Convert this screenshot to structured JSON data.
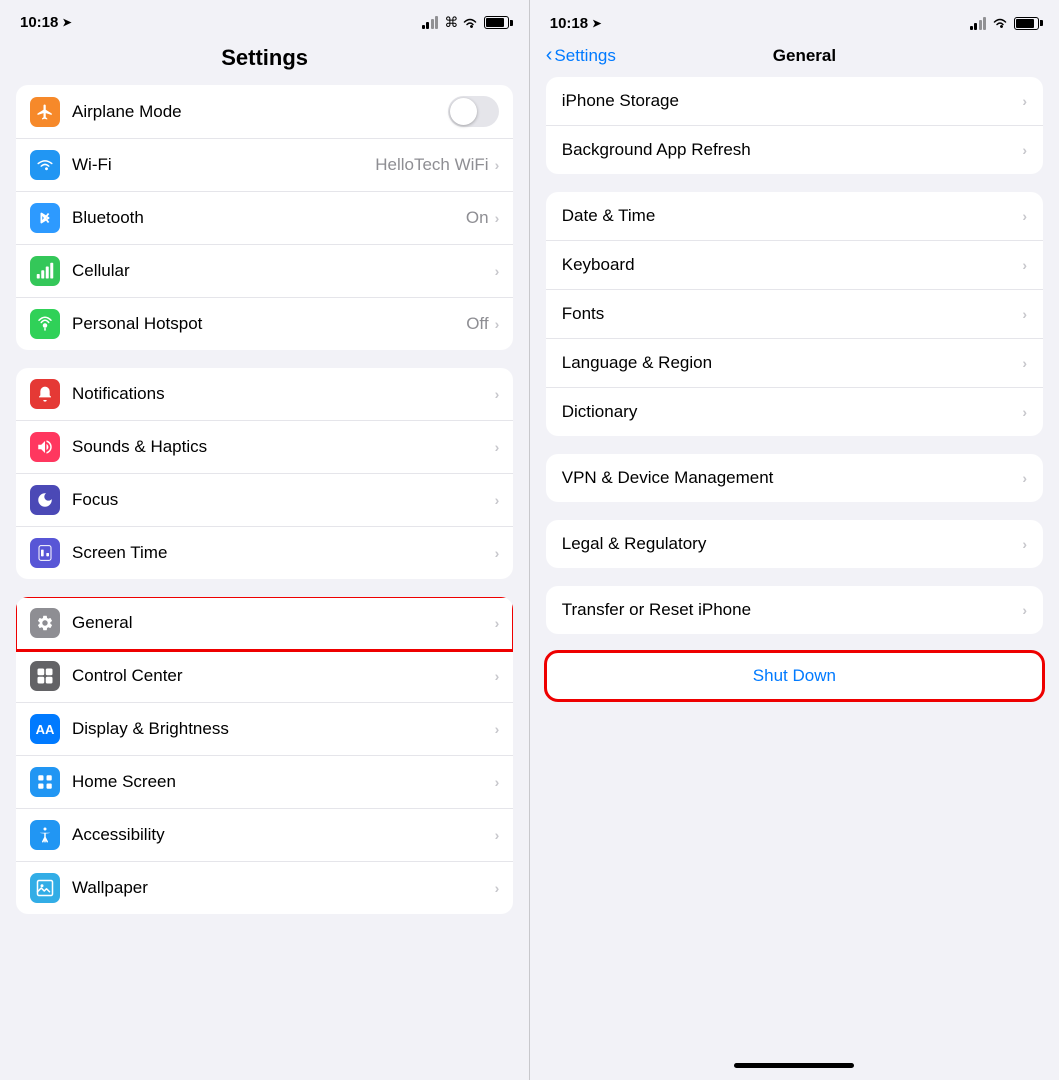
{
  "left": {
    "status": {
      "time": "10:18",
      "arrow": "➤"
    },
    "title": "Settings",
    "groups": [
      {
        "id": "connectivity",
        "rows": [
          {
            "id": "airplane",
            "icon": "✈",
            "iconClass": "icon-orange",
            "label": "Airplane Mode",
            "value": "",
            "type": "toggle",
            "toggleOn": false
          },
          {
            "id": "wifi",
            "icon": "wifi",
            "iconClass": "icon-blue",
            "label": "Wi-Fi",
            "value": "HelloTech WiFi",
            "type": "chevron"
          },
          {
            "id": "bluetooth",
            "icon": "bluetooth",
            "iconClass": "icon-blue-mid",
            "label": "Bluetooth",
            "value": "On",
            "type": "chevron"
          },
          {
            "id": "cellular",
            "icon": "cellular",
            "iconClass": "icon-green",
            "label": "Cellular",
            "value": "",
            "type": "chevron"
          },
          {
            "id": "hotspot",
            "icon": "hotspot",
            "iconClass": "icon-green-mid",
            "label": "Personal Hotspot",
            "value": "Off",
            "type": "chevron"
          }
        ]
      },
      {
        "id": "system1",
        "rows": [
          {
            "id": "notifications",
            "icon": "notif",
            "iconClass": "icon-red",
            "label": "Notifications",
            "value": "",
            "type": "chevron"
          },
          {
            "id": "sounds",
            "icon": "sounds",
            "iconClass": "icon-pink",
            "label": "Sounds & Haptics",
            "value": "",
            "type": "chevron"
          },
          {
            "id": "focus",
            "icon": "focus",
            "iconClass": "icon-indigo",
            "label": "Focus",
            "value": "",
            "type": "chevron"
          },
          {
            "id": "screentime",
            "icon": "screentime",
            "iconClass": "icon-purple",
            "label": "Screen Time",
            "value": "",
            "type": "chevron"
          }
        ]
      },
      {
        "id": "system2",
        "rows": [
          {
            "id": "general",
            "icon": "gear",
            "iconClass": "icon-gray",
            "label": "General",
            "value": "",
            "type": "chevron",
            "highlighted": true
          },
          {
            "id": "controlcenter",
            "icon": "cc",
            "iconClass": "icon-gray-dark",
            "label": "Control Center",
            "value": "",
            "type": "chevron"
          },
          {
            "id": "display",
            "icon": "AA",
            "iconClass": "icon-blue-bright",
            "label": "Display & Brightness",
            "value": "",
            "type": "chevron"
          },
          {
            "id": "homescreen",
            "icon": "home",
            "iconClass": "icon-blue",
            "label": "Home Screen",
            "value": "",
            "type": "chevron"
          },
          {
            "id": "accessibility",
            "icon": "access",
            "iconClass": "icon-blue",
            "label": "Accessibility",
            "value": "",
            "type": "chevron"
          },
          {
            "id": "wallpaper",
            "icon": "wp",
            "iconClass": "icon-teal",
            "label": "Wallpaper",
            "value": "",
            "type": "chevron"
          }
        ]
      }
    ]
  },
  "right": {
    "status": {
      "time": "10:18",
      "arrow": "➤"
    },
    "nav": {
      "backLabel": "Settings",
      "title": "General"
    },
    "groups": [
      {
        "id": "storage",
        "rows": [
          {
            "id": "iphone-storage",
            "label": "iPhone Storage",
            "type": "chevron"
          },
          {
            "id": "bg-refresh",
            "label": "Background App Refresh",
            "type": "chevron"
          }
        ]
      },
      {
        "id": "locale",
        "rows": [
          {
            "id": "datetime",
            "label": "Date & Time",
            "type": "chevron"
          },
          {
            "id": "keyboard",
            "label": "Keyboard",
            "type": "chevron"
          },
          {
            "id": "fonts",
            "label": "Fonts",
            "type": "chevron"
          },
          {
            "id": "language",
            "label": "Language & Region",
            "type": "chevron"
          },
          {
            "id": "dictionary",
            "label": "Dictionary",
            "type": "chevron"
          }
        ]
      },
      {
        "id": "vpn",
        "rows": [
          {
            "id": "vpn-mgmt",
            "label": "VPN & Device Management",
            "type": "chevron"
          }
        ]
      },
      {
        "id": "legal",
        "rows": [
          {
            "id": "legal-reg",
            "label": "Legal & Regulatory",
            "type": "chevron"
          }
        ]
      },
      {
        "id": "transfer",
        "rows": [
          {
            "id": "transfer-reset",
            "label": "Transfer or Reset iPhone",
            "type": "chevron"
          }
        ]
      },
      {
        "id": "shutdown",
        "rows": [
          {
            "id": "shutdown",
            "label": "Shut Down",
            "type": "action",
            "highlighted": true
          }
        ]
      }
    ]
  },
  "icons": {
    "airplane": "✈",
    "wifi": "📶",
    "bluetooth": "⬡",
    "cellular": "((·))",
    "hotspot": "∞",
    "notif": "🔔",
    "sounds": "🔊",
    "focus": "🌙",
    "screentime": "⏳",
    "gear": "⚙",
    "cc": "⊞",
    "AA": "AA",
    "home": "⊞",
    "access": "⓪",
    "wp": "❋"
  }
}
